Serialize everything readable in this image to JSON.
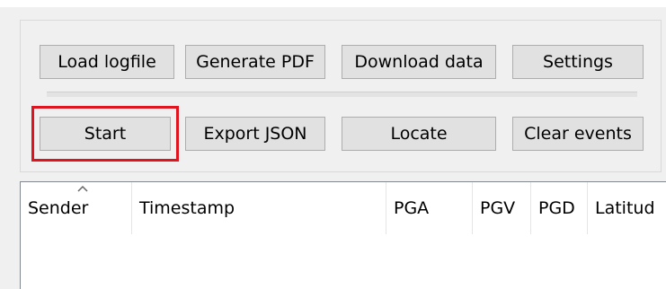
{
  "toolbar": {
    "row1": {
      "load_logfile": "Load logfile",
      "generate_pdf": "Generate PDF",
      "download_data": "Download data",
      "settings": "Settings"
    },
    "row2": {
      "start": "Start",
      "export_json": "Export JSON",
      "locate": "Locate",
      "clear_events": "Clear events"
    }
  },
  "table": {
    "columns": [
      "Sender",
      "Timestamp",
      "PGA",
      "PGV",
      "PGD",
      "Latitud"
    ],
    "sorted_column": "Sender",
    "sort_direction": "ascending",
    "rows": []
  },
  "colors": {
    "highlight": "#e0141e",
    "button_face": "#e1e1e1",
    "window_bg": "#f0f0f0"
  }
}
